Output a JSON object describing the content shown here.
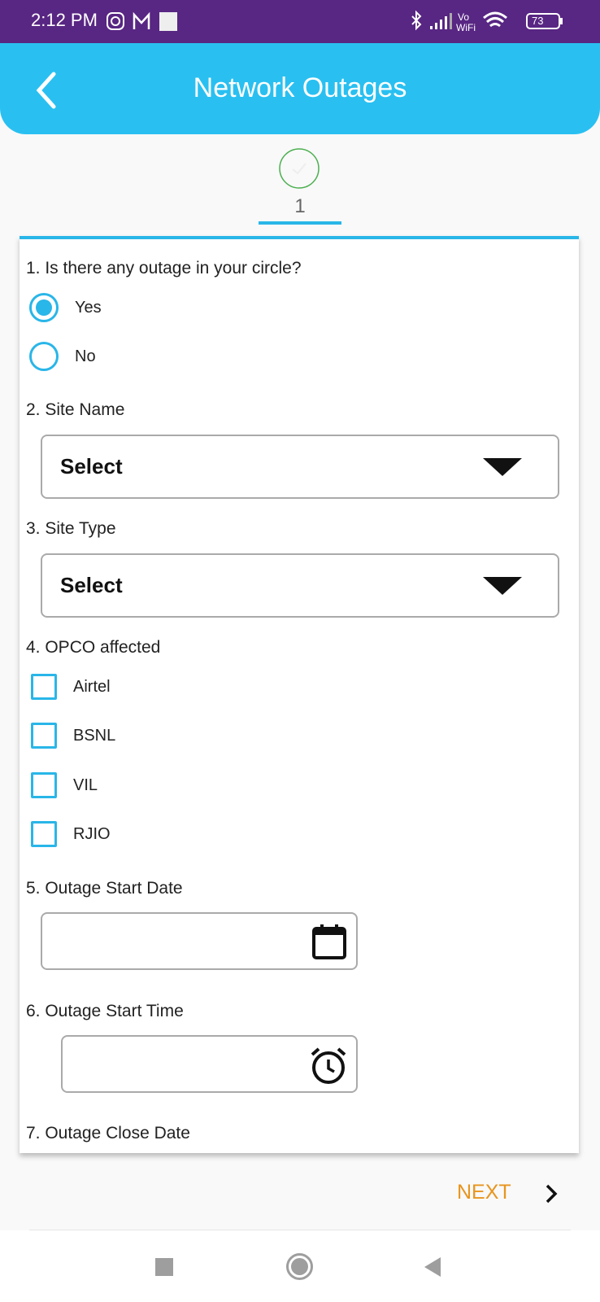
{
  "status_bar": {
    "time": "2:12 PM",
    "battery": "73",
    "icons": [
      "instagram-icon",
      "gmail-icon",
      "image-icon",
      "bluetooth-icon",
      "signal-icon",
      "vowifi-icon",
      "wifi-icon",
      "battery-icon"
    ],
    "vowifi": "Vo WiFi"
  },
  "header": {
    "title": "Network Outages",
    "back_icon": "chevron-left-icon"
  },
  "stepper": {
    "step": "1",
    "completed": true
  },
  "form": {
    "q1": {
      "label": "1. Is there any outage in your circle?",
      "options": [
        "Yes",
        "No"
      ],
      "selected": "Yes"
    },
    "q2": {
      "label": "2. Site Name",
      "value": "Select"
    },
    "q3": {
      "label": "3. Site Type",
      "value": "Select"
    },
    "q4": {
      "label": "4. OPCO affected",
      "options": [
        "Airtel",
        "BSNL",
        "VIL",
        "RJIO"
      ]
    },
    "q5": {
      "label": "5. Outage Start Date",
      "value": ""
    },
    "q6": {
      "label": "6. Outage Start Time",
      "value": ""
    },
    "q7": {
      "label": "7. Outage Close Date"
    }
  },
  "footer": {
    "next_label": "NEXT"
  },
  "colors": {
    "status_bar": "#582683",
    "header": "#29c0f1",
    "accent": "#29b6e8",
    "next": "#e8951e",
    "step_check": "#4caf50"
  }
}
